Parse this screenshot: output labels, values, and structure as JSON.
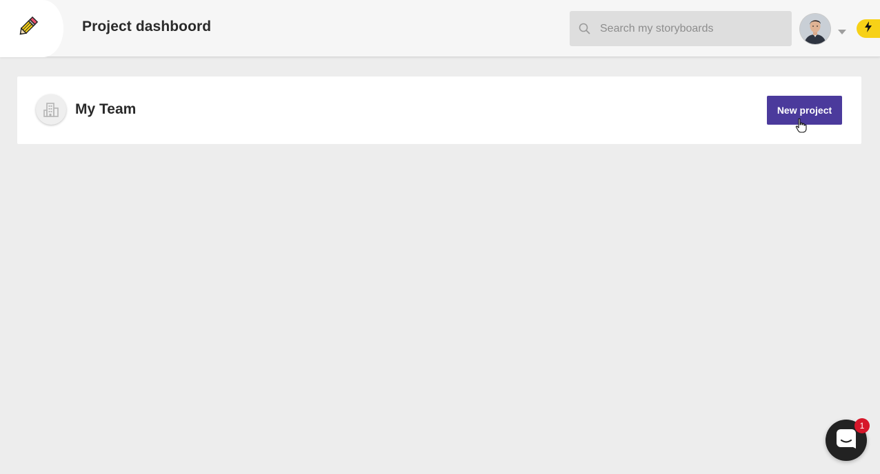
{
  "header": {
    "logo_icon": "pencil-eraser-icon",
    "title": "Project dashboord",
    "search": {
      "placeholder": "Search my storyboards",
      "value": "",
      "icon": "search-icon"
    },
    "avatar_icon": "user-avatar",
    "caret_icon": "chevron-down-icon",
    "upgrade_icon": "lightning-bolt-icon"
  },
  "team": {
    "icon": "building-icon",
    "name": "My Team",
    "new_project_label": "New project"
  },
  "chat": {
    "icon": "chat-icon",
    "unread_count": "1"
  },
  "colors": {
    "accent": "#4b3a9c",
    "badge_yellow": "#f7d117",
    "notification_red": "#d6172a",
    "background": "#ededed"
  }
}
